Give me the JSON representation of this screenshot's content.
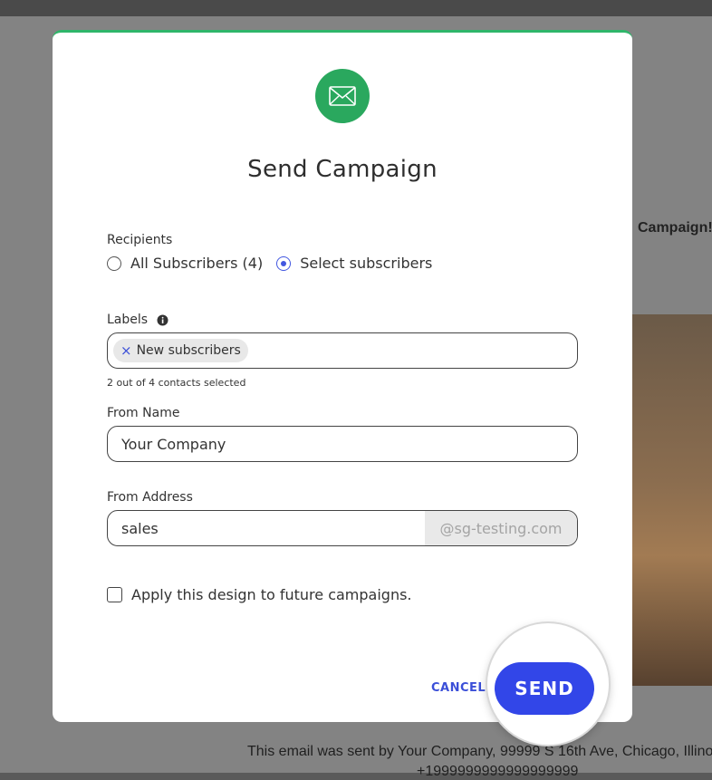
{
  "background": {
    "heading": "Campaign!",
    "footer_line1": "This email was sent by Your Company, 99999 S 16th Ave, Chicago, Illino",
    "footer_line2": "+1999999999999999999"
  },
  "modal": {
    "icon": "envelope-icon",
    "title": "Send Campaign",
    "accent_color": "#2fb66a",
    "recipients": {
      "label": "Recipients",
      "options": [
        {
          "label": "All Subscribers (4)",
          "selected": false
        },
        {
          "label": "Select subscribers",
          "selected": true
        }
      ]
    },
    "labels": {
      "label": "Labels",
      "info_icon": "info-icon",
      "chips": [
        "New subscribers"
      ],
      "chip_remove_glyph": "×",
      "hint": "2 out of 4 contacts selected"
    },
    "from_name": {
      "label": "From Name",
      "value": "Your Company"
    },
    "from_address": {
      "label": "From Address",
      "value": "sales",
      "suffix": "@sg-testing.com"
    },
    "apply_design": {
      "label": "Apply this design to future campaigns.",
      "checked": false
    },
    "actions": {
      "cancel": "CANCEL",
      "send": "SEND",
      "send_color": "#3246e8"
    }
  }
}
